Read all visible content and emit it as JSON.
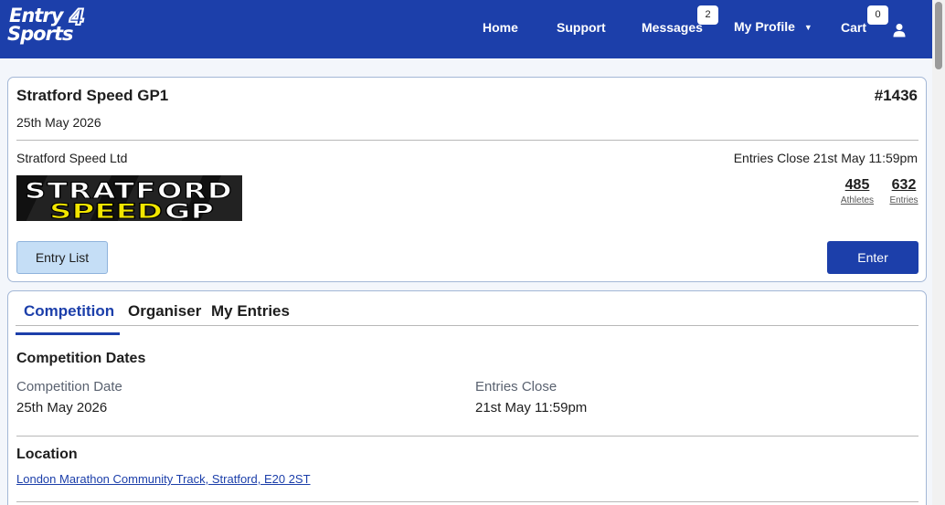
{
  "brand": {
    "logo_line1": "Entry",
    "logo_number": "4",
    "logo_line2": "Sports"
  },
  "nav": {
    "home": "Home",
    "support": "Support",
    "messages": "Messages",
    "messages_badge": "2",
    "profile": "My Profile",
    "profile_caret": "▼",
    "cart": "Cart",
    "cart_badge": "0",
    "user_icon": "user-icon"
  },
  "event": {
    "title": "Stratford Speed GP1",
    "number": "#1436",
    "date": "25th May 2026",
    "organiser": "Stratford Speed Ltd",
    "entries_close": "Entries Close 21st May 11:59pm",
    "logo_text_top": "STRATFORD",
    "logo_text_bottom_yellow": "SPEED",
    "logo_text_bottom_white": "GP",
    "athletes_count": "485",
    "athletes_label": "Athletes",
    "entries_count": "632",
    "entries_label": "Entries",
    "entry_list_button": "Entry List",
    "enter_button": "Enter"
  },
  "tabs": [
    {
      "label": "Competition",
      "active": true
    },
    {
      "label": "Organiser",
      "active": false
    },
    {
      "label": "My Entries",
      "active": false
    }
  ],
  "competition": {
    "dates_title": "Competition Dates",
    "comp_date_label": "Competition Date",
    "comp_date_value": "25th May 2026",
    "entries_close_label": "Entries Close",
    "entries_close_value": "21st May 11:59pm",
    "location_title": "Location",
    "location_link": "London Marathon Community Track, Stratford, E20 2ST"
  },
  "colors": {
    "brand_blue": "#1c3faa",
    "accent_yellow": "#f2e600",
    "light_button": "#c5def6"
  }
}
